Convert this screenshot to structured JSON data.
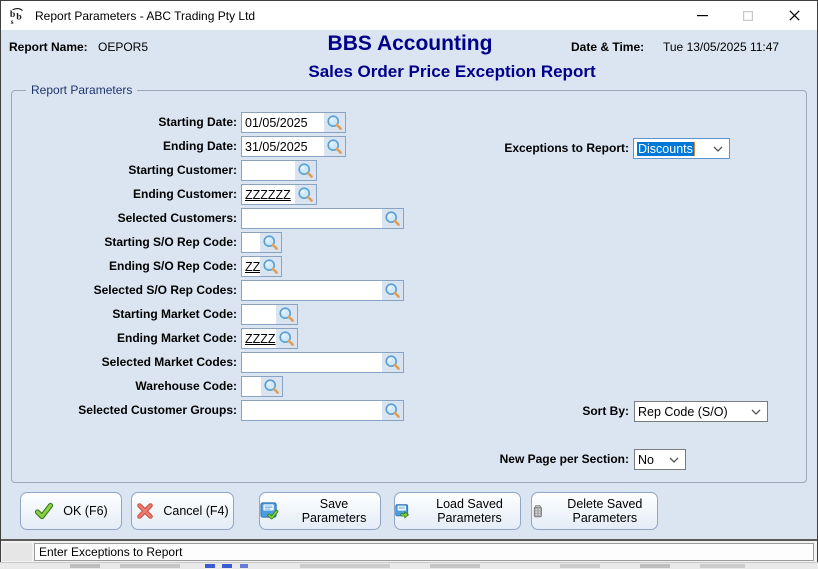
{
  "window": {
    "title": "Report Parameters - ABC Trading Pty Ltd"
  },
  "header": {
    "report_name_label": "Report Name:",
    "report_name_value": "OEPOR5",
    "app_title": "BBS Accounting",
    "report_title": "Sales Order Price Exception Report",
    "datetime_label": "Date & Time:",
    "datetime_value": "Tue 13/05/2025 11:47"
  },
  "group": {
    "title": "Report Parameters"
  },
  "fields": [
    {
      "label": "Starting Date:",
      "value": "01/05/2025"
    },
    {
      "label": "Ending Date:",
      "value": "31/05/2025"
    },
    {
      "label": "Starting Customer:",
      "value": ""
    },
    {
      "label": "Ending Customer:",
      "value": "ZZZZZZ"
    },
    {
      "label": "Selected Customers:",
      "value": ""
    },
    {
      "label": "Starting S/O Rep Code:",
      "value": ""
    },
    {
      "label": "Ending S/O Rep Code:",
      "value": "ZZ"
    },
    {
      "label": "Selected S/O Rep Codes:",
      "value": ""
    },
    {
      "label": "Starting Market Code:",
      "value": ""
    },
    {
      "label": "Ending Market Code:",
      "value": "ZZZZ"
    },
    {
      "label": "Selected Market Codes:",
      "value": ""
    },
    {
      "label": "Warehouse Code:",
      "value": ""
    },
    {
      "label": "Selected Customer Groups:",
      "value": ""
    }
  ],
  "selects": {
    "exceptions": {
      "label": "Exceptions to Report:",
      "value": "Discounts"
    },
    "sort_by": {
      "label": "Sort By:",
      "value": "Rep Code (S/O)"
    },
    "new_page": {
      "label": "New Page per Section:",
      "value": "No"
    }
  },
  "buttons": {
    "ok": "OK (F6)",
    "cancel": "Cancel (F4)",
    "save": "Save Parameters",
    "load": "Load Saved Parameters",
    "delete": "Delete Saved Parameters"
  },
  "statusbar": {
    "text": "Enter Exceptions to Report"
  },
  "colors": {
    "background": "#dbe5f1",
    "title_navy": "#00008b",
    "selection_blue": "#0078d7"
  }
}
